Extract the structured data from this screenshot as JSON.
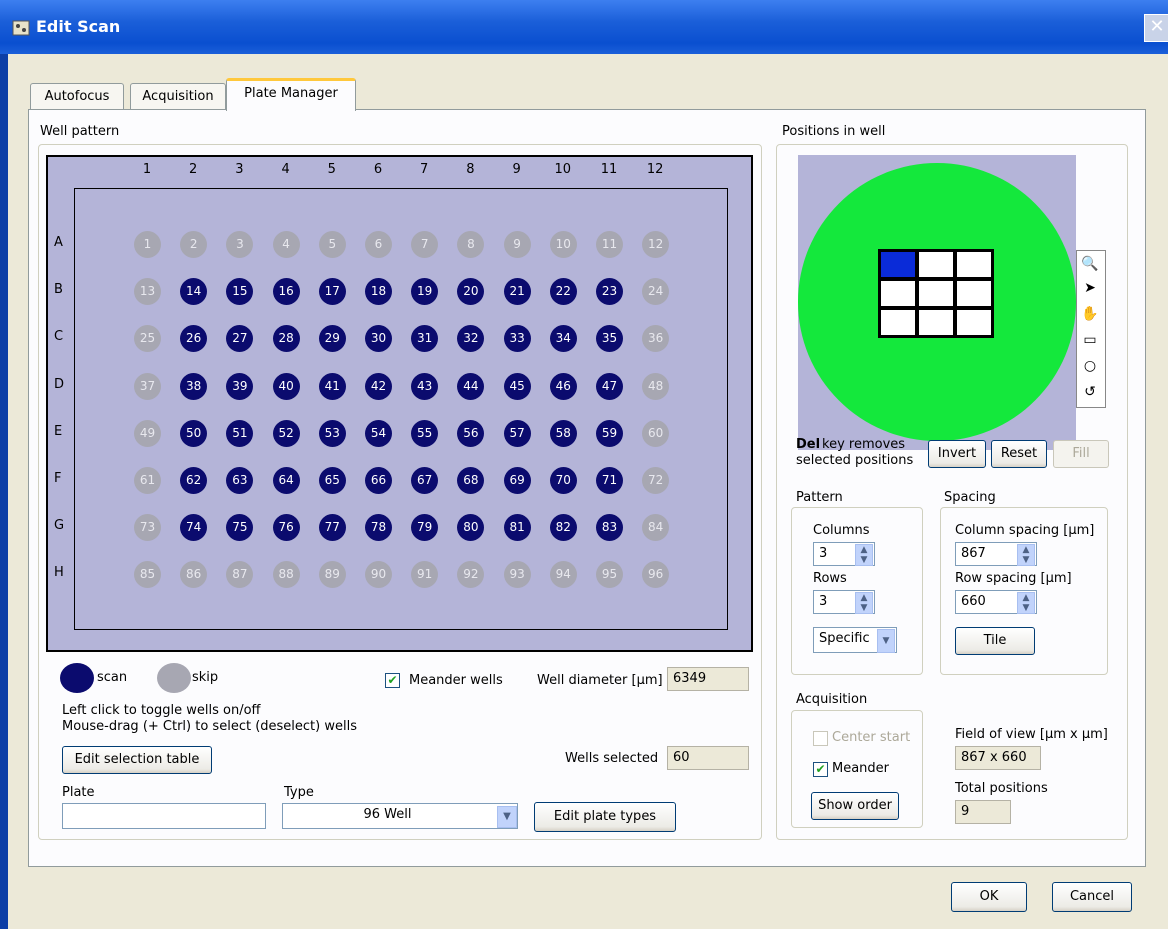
{
  "window": {
    "title": "Edit Scan"
  },
  "tabs": [
    {
      "label": "Autofocus"
    },
    {
      "label": "Acquisition"
    },
    {
      "label": "Plate Manager"
    }
  ],
  "well_pattern": {
    "label": "Well pattern",
    "columns": [
      "1",
      "2",
      "3",
      "4",
      "5",
      "6",
      "7",
      "8",
      "9",
      "10",
      "11",
      "12"
    ],
    "rows": [
      "A",
      "B",
      "C",
      "D",
      "E",
      "F",
      "G",
      "H"
    ],
    "scan_color": "#0b0b6e",
    "skip_color": "#a7a7b2",
    "wells_scanned": [
      14,
      15,
      16,
      17,
      18,
      19,
      20,
      21,
      22,
      23,
      26,
      27,
      28,
      29,
      30,
      31,
      32,
      33,
      34,
      35,
      38,
      39,
      40,
      41,
      42,
      43,
      44,
      45,
      46,
      47,
      50,
      51,
      52,
      53,
      54,
      55,
      56,
      57,
      58,
      59,
      62,
      63,
      64,
      65,
      66,
      67,
      68,
      69,
      70,
      71,
      74,
      75,
      76,
      77,
      78,
      79,
      80,
      81,
      82,
      83
    ]
  },
  "legend": {
    "scan_label": "scan",
    "skip_label": "skip"
  },
  "meander_wells": {
    "label": "Meander wells",
    "checked": true
  },
  "well_diameter": {
    "label": "Well diameter [µm]",
    "value": "6349"
  },
  "instructions": {
    "line1": "Left click to toggle wells on/off",
    "line2": "Mouse-drag (+ Ctrl)  to select (deselect) wells"
  },
  "edit_selection_table": "Edit selection table",
  "wells_selected": {
    "label": "Wells selected",
    "value": "60"
  },
  "plate": {
    "label": "Plate",
    "value": ""
  },
  "type": {
    "label": "Type",
    "value": "96 Well"
  },
  "edit_plate_types": "Edit plate types",
  "positions": {
    "label": "Positions in well",
    "well_color": "#14e83c",
    "selected_color": "#0a2bd8",
    "grid_columns": 3,
    "grid_rows": 3,
    "selected_index": 0,
    "tools": [
      "zoom-icon",
      "pointer-icon",
      "hand-icon",
      "rectangle-icon",
      "circle-icon",
      "lasso-icon"
    ]
  },
  "del_hint": {
    "bold": "Del",
    "rest1": " key removes",
    "line2": "selected positions"
  },
  "invert_button": "Invert",
  "reset_button": "Reset",
  "fill_button": "Fill",
  "pattern": {
    "label": "Pattern",
    "columns_label": "Columns",
    "columns_value": "3",
    "rows_label": "Rows",
    "rows_value": "3",
    "mode": "Specific"
  },
  "spacing": {
    "label": "Spacing",
    "column_label": "Column spacing [µm]",
    "column_value": "867",
    "row_label": "Row spacing [µm]",
    "row_value": "660",
    "tile_button": "Tile"
  },
  "acquisition": {
    "label": "Acquisition",
    "center_start": "Center start",
    "center_start_checked": false,
    "meander": "Meander",
    "meander_checked": true,
    "show_order": "Show order"
  },
  "field_of_view": {
    "label": "Field of view [µm x µm]",
    "value": "867 x 660"
  },
  "total_positions": {
    "label": "Total positions",
    "value": "9"
  },
  "ok_button": "OK",
  "cancel_button": "Cancel"
}
